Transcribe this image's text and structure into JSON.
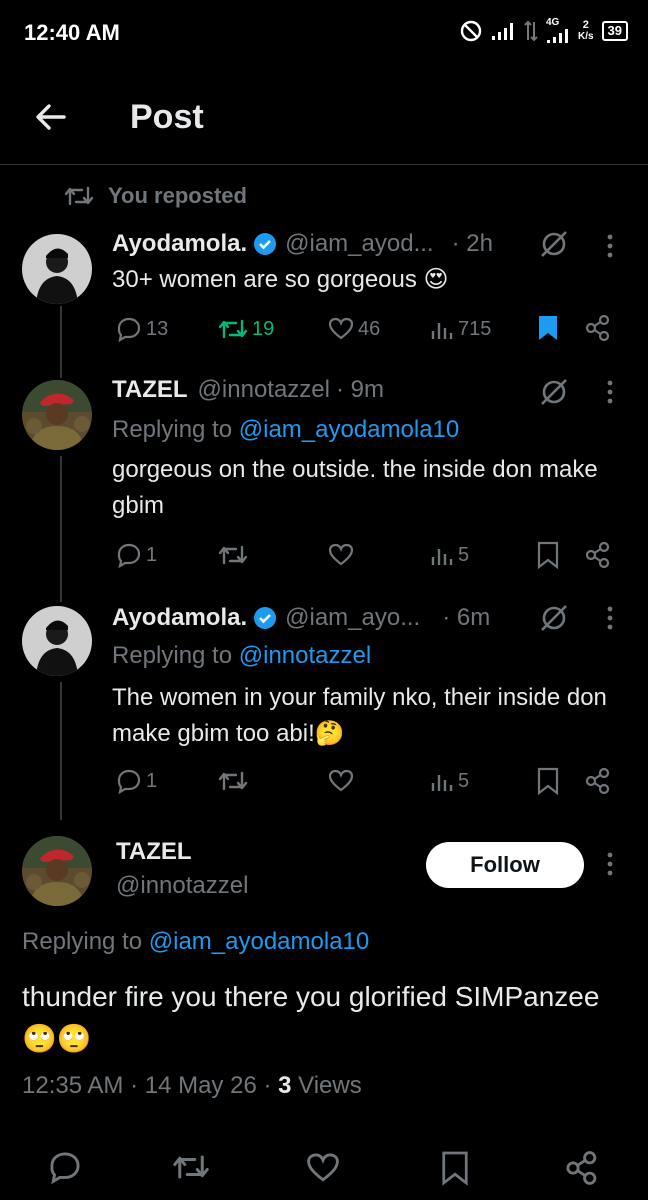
{
  "status_bar": {
    "time": "12:40 AM",
    "net_4g": "4G",
    "speed": "2",
    "speed_unit": "K/s",
    "battery": "39"
  },
  "header": {
    "title": "Post"
  },
  "repost": {
    "label": "You reposted"
  },
  "tweets": [
    {
      "name": "Ayodamola.",
      "handle": "@iam_ayod...",
      "time": "· 2h",
      "text": "30+ women are so gorgeous 😍",
      "replies": "13",
      "reposts": "19",
      "likes": "46",
      "views": "715"
    },
    {
      "name": "TAZEL",
      "handle": "@innotazzel",
      "time": "· 9m",
      "reply_prefix": "Replying to",
      "reply_to": "@iam_ayodamola10",
      "text": "gorgeous on the outside. the inside don make gbim",
      "replies": "1",
      "views": "5"
    },
    {
      "name": "Ayodamola.",
      "handle": "@iam_ayo...",
      "time": "· 6m",
      "reply_prefix": "Replying to",
      "reply_to": "@innotazzel",
      "text": "The women in your family nko, their inside don make gbim too abi!🤔",
      "replies": "1",
      "views": "5"
    }
  ],
  "focused": {
    "name": "TAZEL",
    "handle": "@innotazzel",
    "follow_label": "Follow",
    "reply_prefix": "Replying to",
    "reply_to": "@iam_ayodamola10",
    "text": "thunder fire you there you glorified SIMPanzee 🙄🙄",
    "time": "12:35 AM · 14 May 26 · ",
    "views_count": "3",
    "views_label": " Views"
  },
  "colors": {
    "background": "#000000",
    "text": "#e7e9ea",
    "muted": "#71767b",
    "link": "#1d9bf0",
    "repost_green": "#00ba7c",
    "bookmark_blue": "#1d9bf0",
    "verified": "#1d9bf0"
  },
  "icons": [
    "back-arrow-icon",
    "repost-icon",
    "verified-icon",
    "grok-icon",
    "more-icon",
    "reply-icon",
    "like-icon",
    "views-icon",
    "bookmark-icon",
    "share-icon"
  ]
}
